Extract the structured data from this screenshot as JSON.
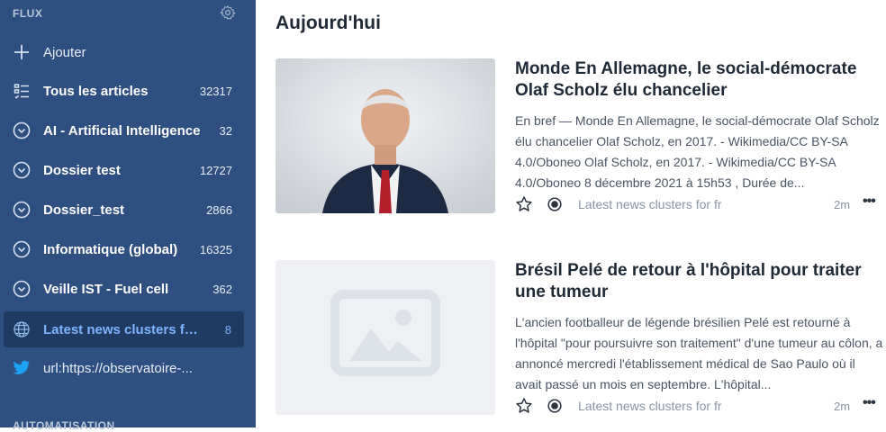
{
  "sidebar": {
    "header": "FLUX",
    "footer": "AUTOMATISATION",
    "add_label": "Ajouter",
    "items": [
      {
        "label": "Tous les articles",
        "count": "32317",
        "icon": "list-icon"
      },
      {
        "label": "AI - Artificial Intelligence",
        "count": "32",
        "icon": "chevron-circle-icon"
      },
      {
        "label": "Dossier test",
        "count": "12727",
        "icon": "chevron-circle-icon"
      },
      {
        "label": "Dossier_test",
        "count": "2866",
        "icon": "chevron-circle-icon"
      },
      {
        "label": "Informatique (global)",
        "count": "16325",
        "icon": "chevron-circle-icon"
      },
      {
        "label": "Veille IST - Fuel cell",
        "count": "362",
        "icon": "chevron-circle-icon"
      },
      {
        "label": "Latest news clusters for...",
        "count": "8",
        "icon": "globe-icon"
      },
      {
        "label": "url:https://observatoire-...",
        "count": "",
        "icon": "twitter-icon"
      }
    ],
    "colors": {
      "background": "#2e4f7f",
      "active": "#203a62",
      "active_text": "#7fb2ff"
    }
  },
  "main": {
    "title": "Aujourd'hui",
    "articles": [
      {
        "title": "Monde En Allemagne, le social-démocrate Olaf Scholz élu chancelier",
        "excerpt": "En bref — Monde En Allemagne, le social-démocrate Olaf Scholz élu chancelier Olaf Scholz, en 2017. - Wikimedia/CC BY-SA 4.0/Oboneo Olaf Scholz, en 2017. - Wikimedia/CC BY-SA 4.0/Oboneo 8 décembre 2021 à 15h53 , Durée de...",
        "source": "Latest news clusters for fr",
        "age": "2m"
      },
      {
        "title": "Brésil Pelé de retour à l'hôpital pour traiter une tumeur",
        "excerpt": "L'ancien footballeur de légende brésilien Pelé est retourné à l'hôpital \"pour poursuivre son traitement\" d'une tumeur au côlon, a annoncé mercredi l'établissement médical de Sao Paulo où il avait passé un mois en septembre. L'hôpital...",
        "source": "Latest news clusters for fr",
        "age": "2m"
      }
    ],
    "more_label": "•••"
  }
}
